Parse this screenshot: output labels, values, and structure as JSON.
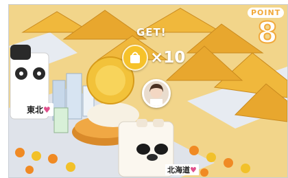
{
  "overlay": {
    "get_label": "GET!",
    "reward_count": "×10",
    "reward_icon": "bag-icon"
  },
  "point": {
    "label": "POINT",
    "number": "8",
    "accent_color": "#f1a93b"
  },
  "characters": {
    "left_tag": "東北",
    "right_tag": "北海道",
    "heart": "♥"
  },
  "colors": {
    "mountain": "#e8a72e",
    "ground": "#f2d58a",
    "road": "#dfe3ea"
  }
}
